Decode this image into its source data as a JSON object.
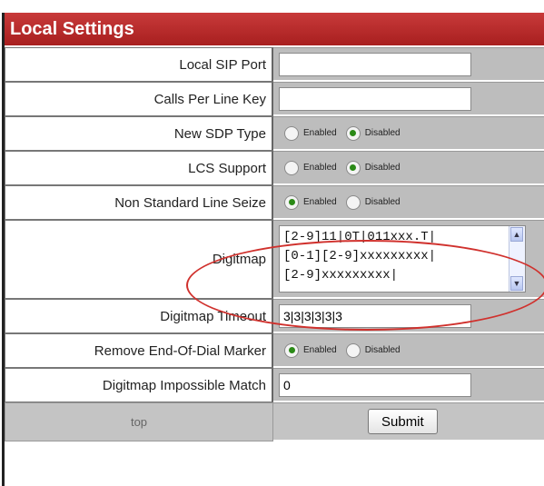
{
  "title": "Local Settings",
  "rows": {
    "local_sip_port": {
      "label": "Local SIP Port",
      "value": ""
    },
    "calls_per_line_key": {
      "label": "Calls Per Line Key",
      "value": ""
    },
    "new_sdp_type": {
      "label": "New SDP Type",
      "selected": "Disabled"
    },
    "lcs_support": {
      "label": "LCS Support",
      "selected": "Disabled"
    },
    "non_standard_line_seize": {
      "label": "Non Standard Line Seize",
      "selected": "Enabled"
    },
    "digitmap": {
      "label": "Digitmap",
      "lines": [
        "[2-9]11|0T|011xxx.T|",
        "[0-1][2-9]xxxxxxxxx|",
        "[2-9]xxxxxxxxx|"
      ]
    },
    "digitmap_timeout": {
      "label": "Digitmap Timeout",
      "value": "3|3|3|3|3|3"
    },
    "remove_end_of_dial_marker": {
      "label": "Remove End-Of-Dial Marker",
      "selected": "Enabled"
    },
    "digitmap_impossible_match": {
      "label": "Digitmap Impossible Match",
      "value": "0"
    }
  },
  "radio_labels": {
    "enabled": "Enabled",
    "disabled": "Disabled"
  },
  "footer": {
    "top_link": "top",
    "submit_label": "Submit"
  },
  "colors": {
    "title_bar": "#b02525",
    "annotation_ellipse": "#d0312d",
    "radio_selected": "#2b8a17"
  }
}
